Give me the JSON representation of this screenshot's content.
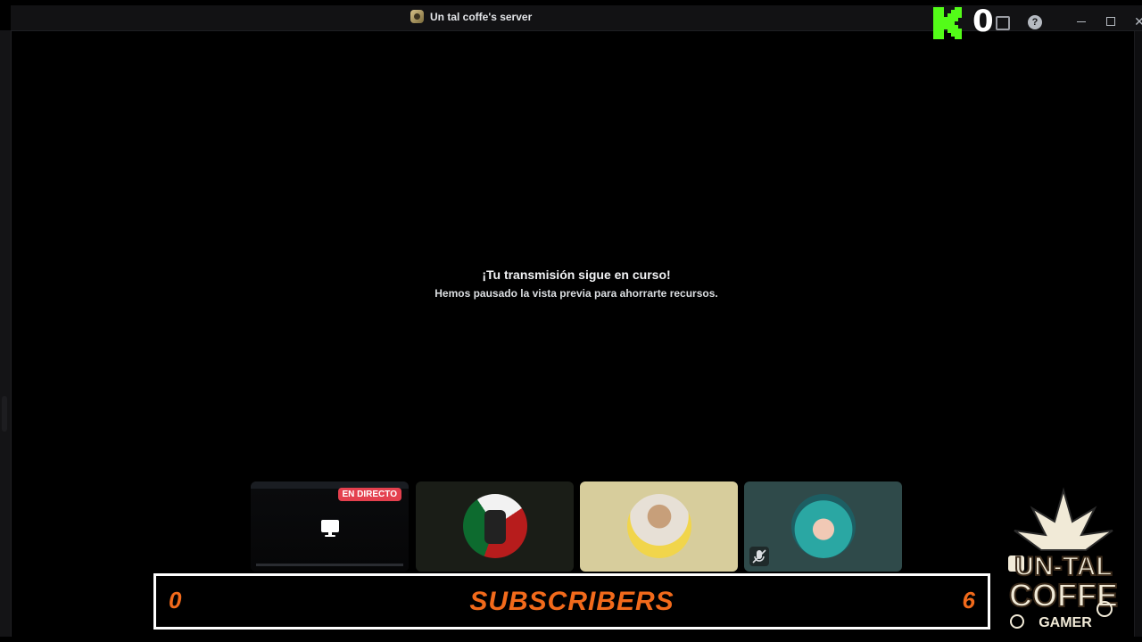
{
  "window": {
    "title": "Un tal coffe's server",
    "controls": {
      "minimize": "minimize-icon",
      "maximize": "maximize-icon",
      "close": "close-icon"
    }
  },
  "overlay": {
    "kick_count": "0",
    "subscribers_label": "SUBSCRIBERS",
    "subscribers_left": "0",
    "subscribers_right": "6",
    "brand_lines": [
      "UN-TAL",
      "COFFE",
      "GAMER"
    ]
  },
  "stream_notice": {
    "title": "¡Tu transmisión sigue en curso!",
    "subtitle": "Hemos pausado la vista previa para ahorrarte recursos."
  },
  "participants": [
    {
      "type": "stream",
      "badge": "EN DIRECTO",
      "icon": "screen-share-icon"
    },
    {
      "type": "user",
      "avatar": "mexico-flag-avatar"
    },
    {
      "type": "user",
      "avatar": "selfie-avatar"
    },
    {
      "type": "user",
      "avatar": "anime-avatar",
      "status_icon": "muted-icon"
    }
  ],
  "colors": {
    "accent_orange": "#f26a1b",
    "live_red": "#e4404e",
    "kick_green": "#53fc18",
    "background": "#000000"
  }
}
